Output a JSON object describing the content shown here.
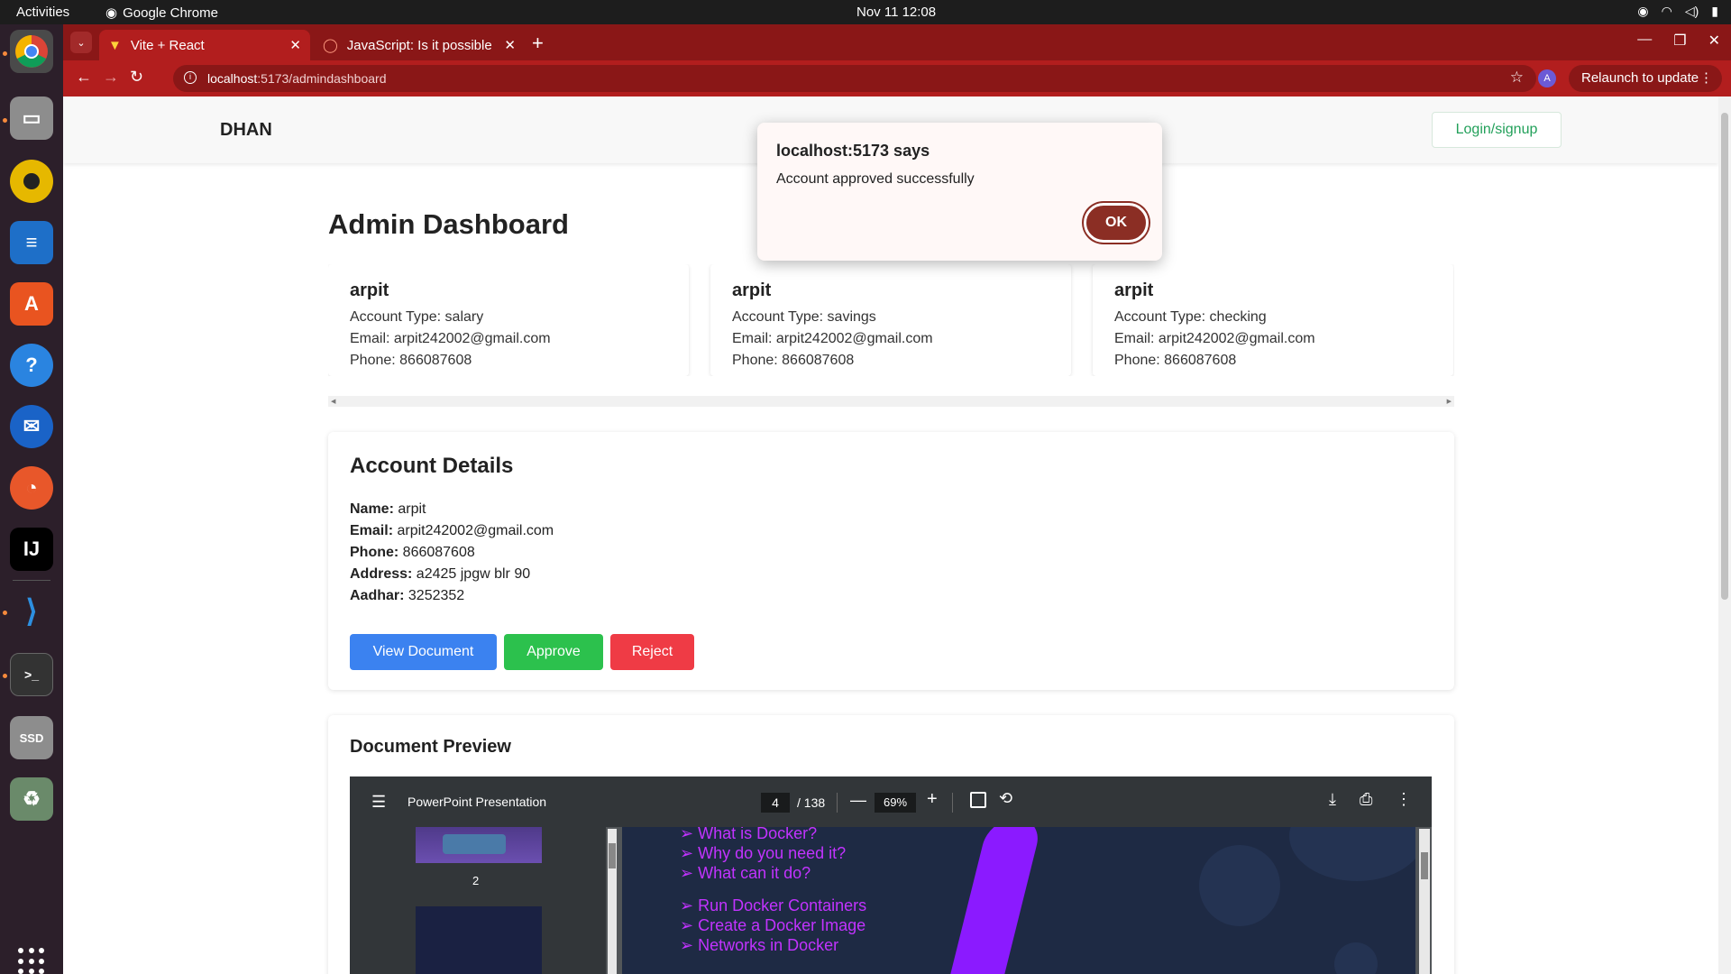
{
  "topbar": {
    "activities": "Activities",
    "app_name": "Google Chrome",
    "clock": "Nov 11  12:08"
  },
  "chrome": {
    "tabs": [
      {
        "title": "Vite + React",
        "active": true
      },
      {
        "title": "JavaScript: Is it possible",
        "active": false
      }
    ],
    "url_host": "localhost",
    "url_rest": ":5173/admindashboard",
    "profile_initial": "A",
    "relaunch_label": "Relaunch to update"
  },
  "page": {
    "brand": "DHAN",
    "login_label": "Login/signup",
    "title": "Admin Dashboard",
    "cards": [
      {
        "name": "arpit",
        "account_type": "Account Type: salary",
        "email": "Email: arpit242002@gmail.com",
        "phone": "Phone: 866087608"
      },
      {
        "name": "arpit",
        "account_type": "Account Type: savings",
        "email": "Email: arpit242002@gmail.com",
        "phone": "Phone: 866087608"
      },
      {
        "name": "arpit",
        "account_type": "Account Type: checking",
        "email": "Email: arpit242002@gmail.com",
        "phone": "Phone: 866087608"
      }
    ],
    "details": {
      "heading": "Account Details",
      "name_label": "Name:",
      "name_value": " arpit",
      "email_label": "Email:",
      "email_value": " arpit242002@gmail.com",
      "phone_label": "Phone:",
      "phone_value": " 866087608",
      "address_label": "Address:",
      "address_value": " a2425 jpgw blr 90",
      "aadhar_label": "Aadhar:",
      "aadhar_value": " 3252352",
      "view_label": "View Document",
      "approve_label": "Approve",
      "reject_label": "Reject"
    },
    "preview": {
      "heading": "Document Preview",
      "pdf_title": "PowerPoint Presentation",
      "current_page": "4",
      "total_pages": "/ 138",
      "zoom": "69%",
      "thumb_number": "2",
      "slide_bullets": [
        "➢ What is Docker?",
        "➢ Why do you need it?",
        "➢ What can it do?",
        "",
        "➢ Run Docker Containers",
        "➢ Create a Docker Image",
        "➢ Networks in Docker"
      ]
    }
  },
  "dialog": {
    "origin": "localhost:5173 says",
    "message": "Account approved successfully",
    "ok_label": "OK"
  },
  "colors": {
    "chrome_tabbar": "#8a1717",
    "chrome_active": "#b21e1e",
    "view_button": "#3b82f0",
    "approve_button": "#2cc14d",
    "reject_button": "#ef3b45",
    "ok_button": "#8b2e24"
  }
}
